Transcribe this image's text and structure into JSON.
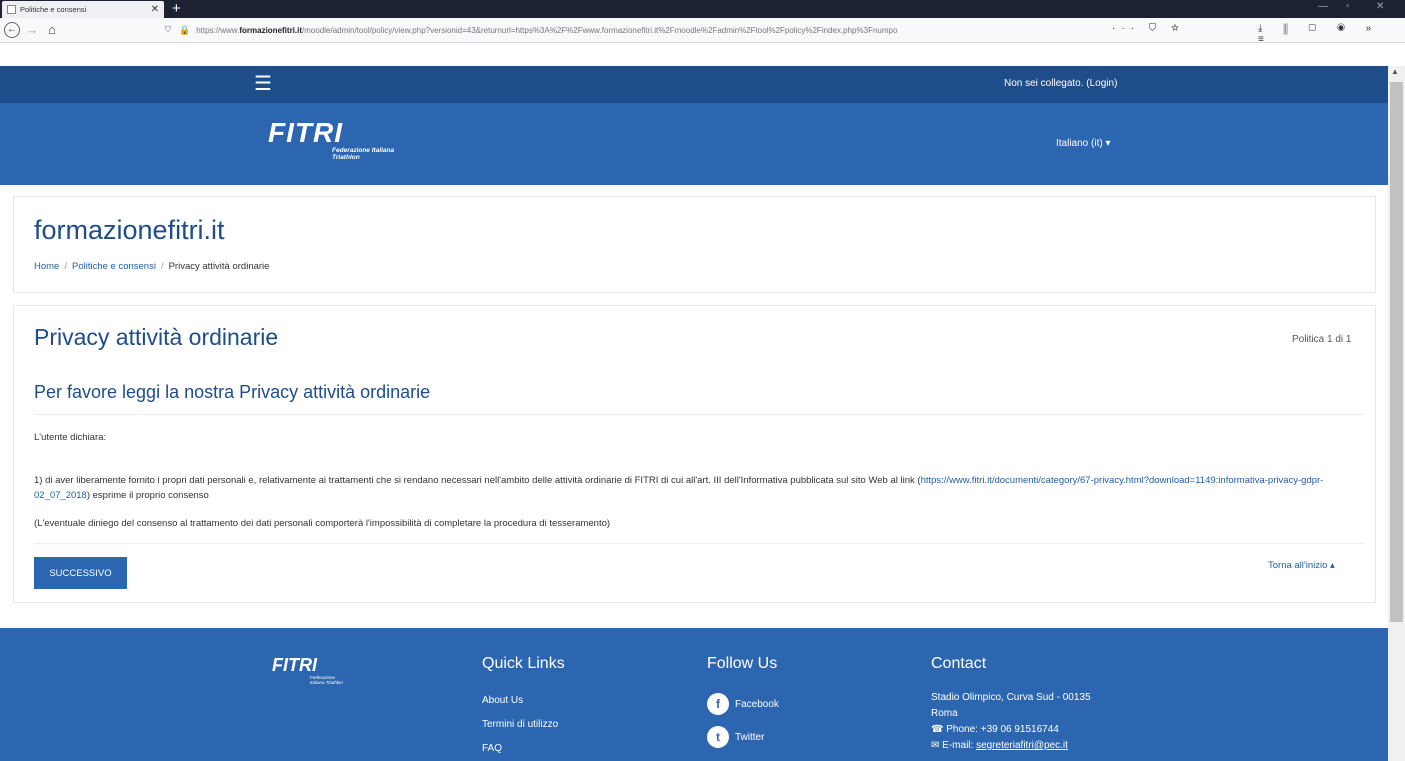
{
  "browser": {
    "tab_title": "Politiche e consensi",
    "url_prefix": "https://www.",
    "url_domain": "formazionefitri.it",
    "url_rest": "/moodle/admin/tool/policy/view.php?versionid=43&returnurl=https%3A%2F%2Fwww.formazionefitri.it%2Fmoodle%2Fadmin%2Ftool%2Fpolicy%2Findex.php%3Fnumpo"
  },
  "topnav": {
    "login_text": "Non sei collegato. (Login)"
  },
  "header": {
    "logo_text": "FITRI",
    "logo_sub": "Federazione Italiana Triathlon",
    "language": "Italiano (it)"
  },
  "site": {
    "title": "formazionefitri.it",
    "breadcrumb": [
      "Home",
      "Politiche e consensi",
      "Privacy attività ordinarie"
    ]
  },
  "policy": {
    "title": "Privacy attività ordinarie",
    "counter": "Politica 1 di 1",
    "subtitle": "Per favore leggi la nostra Privacy attività ordinarie",
    "intro": "L'utente dichiara:",
    "item1_start": "1) di aver liberamente fornito i propri dati personali e, relativamente ai trattamenti che si rendano necessari nell'ambito delle attività ordinarie di FITRI di cui all'art. III dell'Informativa pubblicata sul sito Web al link (",
    "item1_link_a": "https://www.fitri.it/documenti/category/67-",
    "item1_link_b": "privacy.html?download=1149:informativa-privacy-gdpr-02_07_2018",
    "item1_end": ") esprime il proprio consenso",
    "note": "(L'eventuale diniego del consenso al trattamento dei dati personali comporterà l'impossibilità di completare la procedura di tesseramento)",
    "next_button": "SUCCESSIVO",
    "back_to_top": "Torna all'inizio ▴"
  },
  "footer": {
    "quick_links_title": "Quick Links",
    "quick_links": [
      "About Us",
      "Termini di utilizzo",
      "FAQ"
    ],
    "follow_title": "Follow Us",
    "follow": [
      "Facebook",
      "Twitter"
    ],
    "contact_title": "Contact",
    "address_line1": "Stadio Olimpico, Curva Sud - 00135",
    "address_line2": "Roma",
    "phone": "Phone: +39 06 91516744",
    "email_label": "E-mail: ",
    "email": "segreteriafitri@pec.it"
  }
}
